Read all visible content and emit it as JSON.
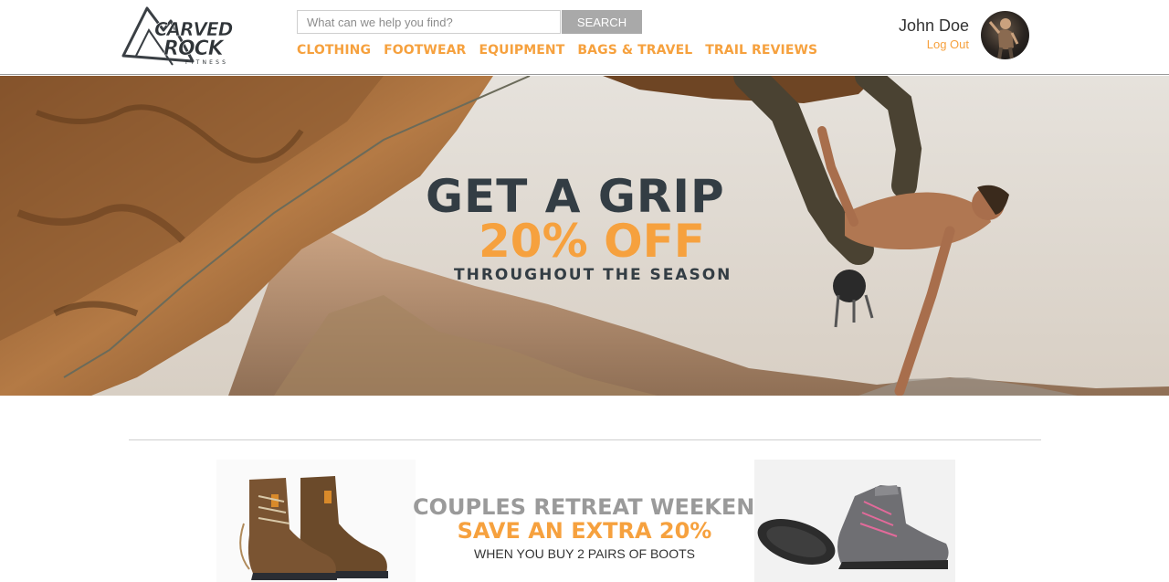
{
  "brand": {
    "logo_text": "CARVED ROCK",
    "logo_subtext": "FITNESS"
  },
  "search": {
    "placeholder": "What can we help you find?",
    "button_label": "SEARCH"
  },
  "nav": {
    "items": [
      {
        "label": "CLOTHING"
      },
      {
        "label": "FOOTWEAR"
      },
      {
        "label": "EQUIPMENT"
      },
      {
        "label": "BAGS & TRAVEL"
      },
      {
        "label": "TRAIL REVIEWS"
      }
    ]
  },
  "user": {
    "name": "John Doe",
    "logout_label": "Log Out"
  },
  "hero": {
    "title": "GET A GRIP",
    "offer": "20% OFF",
    "subtitle": "THROUGHOUT THE SEASON"
  },
  "promo": {
    "title": "COUPLES RETREAT WEEKEND",
    "offer": "SAVE AN EXTRA 20%",
    "subtitle": "WHEN YOU BUY 2 PAIRS OF BOOTS"
  },
  "colors": {
    "accent": "#f6a13e",
    "dark_text": "#333d44",
    "muted_text": "#9a9a9a",
    "search_button": "#a9a9a9"
  }
}
